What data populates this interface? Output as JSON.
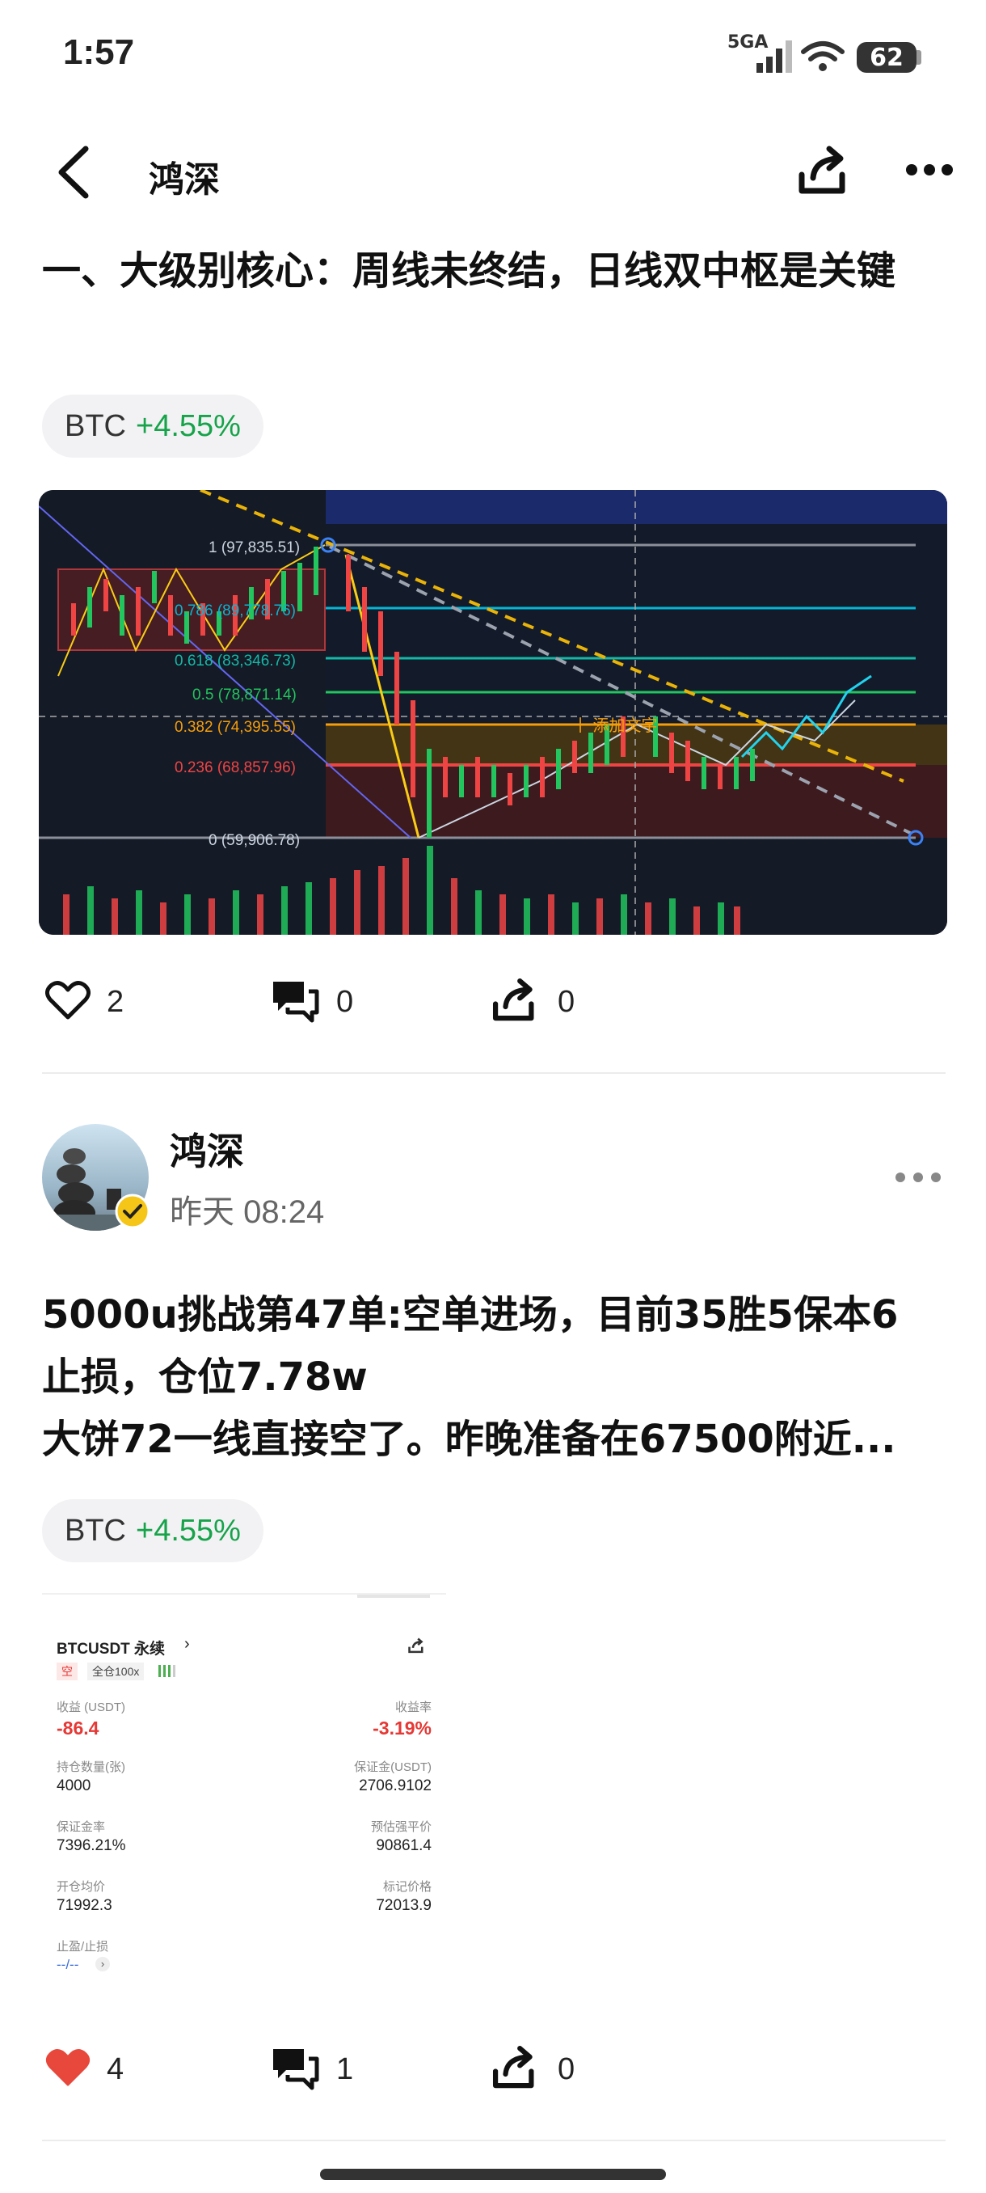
{
  "status_bar": {
    "time": "1:57",
    "network": "5GA",
    "battery": "62"
  },
  "nav": {
    "title": "鸿深"
  },
  "article": {
    "heading": "一、大级别核心：周线未终结，日线双中枢是关键",
    "tag": {
      "symbol": "BTC",
      "change": "+4.55%"
    },
    "chart_labels": {
      "fib_1": "1 (97,835.51)",
      "fib_786": "0.786 (89,778.76)",
      "fib_618": "0.618 (83,346.73)",
      "fib_5": "0.5 (78,871.14)",
      "fib_382": "0.382 (74,395.55)",
      "fib_236": "0.236 (68,857.96)",
      "fib_0": "0 (59,906.78)",
      "overlay_text": "十 添加文字"
    },
    "actions": {
      "likes": "2",
      "comments": "0",
      "shares": "0"
    }
  },
  "post": {
    "author": "鸿深",
    "time": "昨天 08:24",
    "lines": [
      "5000u挑战第47单:空单进场，目前35胜5保本6",
      "止损，仓位7.78w",
      "大饼72一线直接空了。昨晚准备在67500附近..."
    ],
    "tag": {
      "symbol": "BTC",
      "change": "+4.55%"
    },
    "screenshot": {
      "pair": "BTCUSDT 永续",
      "side": "空",
      "leverage": "全仓100x",
      "pnl_label": "收益 (USDT)",
      "pnl_value": "-86.4",
      "roi_label": "收益率",
      "roi_value": "-3.19%",
      "qty_label": "持仓数量(张)",
      "qty_value": "4000",
      "margin_label": "保证金(USDT)",
      "margin_value": "2706.9102",
      "margin_ratio_label": "保证金率",
      "margin_ratio_value": "7396.21%",
      "liq_label": "预估强平价",
      "liq_value": "90861.4",
      "entry_label": "开仓均价",
      "entry_value": "71992.3",
      "mark_label": "标记价格",
      "mark_value": "72013.9",
      "tpsl_label": "止盈/止损",
      "tpsl_value": "--/--"
    },
    "actions": {
      "likes": "4",
      "comments": "1",
      "shares": "0"
    }
  },
  "colors": {
    "like_active": "#e8473b",
    "positive": "#16a34a",
    "chart_bg": "#141a26",
    "fib_red": "#ef4444",
    "fib_orange": "#f59e0b",
    "fib_green": "#22c55e",
    "fib_teal": "#14b8a6",
    "fib_cyan": "#06b6d4"
  },
  "icons": [
    "back-icon",
    "share-icon",
    "more-icon",
    "heart-icon",
    "comment-icon",
    "repost-icon",
    "verified-badge-icon"
  ]
}
